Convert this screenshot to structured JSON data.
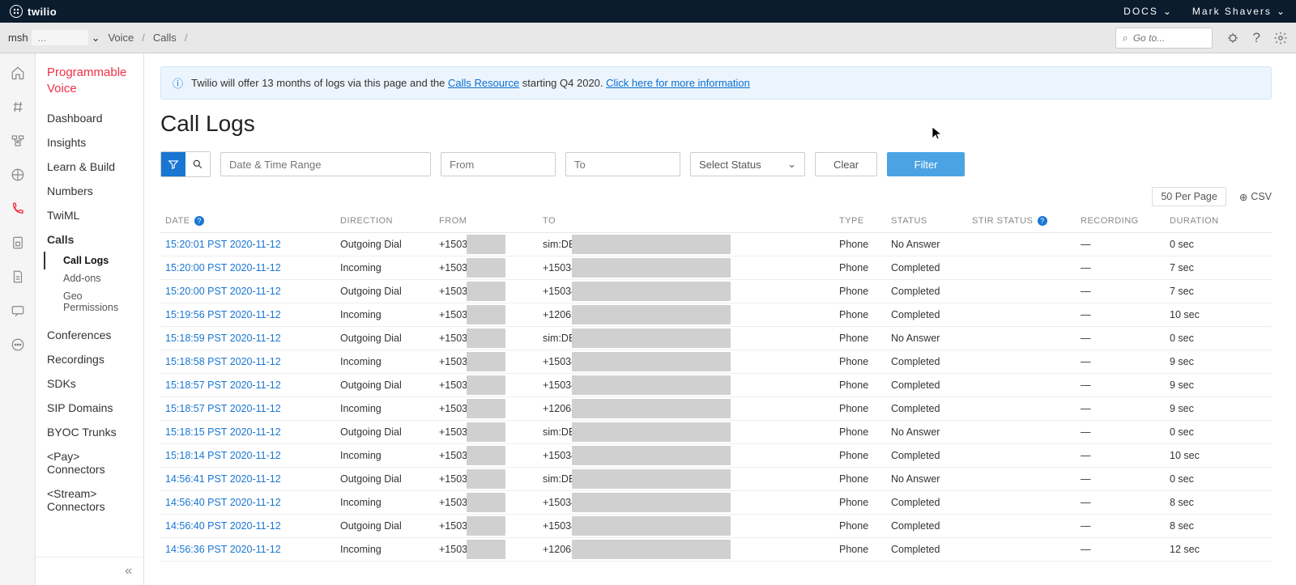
{
  "topbar": {
    "brand": "twilio",
    "docs": "DOCS",
    "user": "Mark Shavers"
  },
  "breadbar": {
    "account_prefix": "msh",
    "account_rest": "...",
    "crumb1": "Voice",
    "crumb2": "Calls",
    "search_placeholder": "Go to..."
  },
  "sidebar": {
    "title": "Programmable Voice",
    "items": [
      "Dashboard",
      "Insights",
      "Learn & Build",
      "Numbers",
      "TwiML",
      "Calls"
    ],
    "subs": [
      "Call Logs",
      "Add-ons",
      "Geo Permissions"
    ],
    "items2": [
      "Conferences",
      "Recordings",
      "SDKs",
      "SIP Domains",
      "BYOC Trunks",
      "<Pay> Connectors",
      "<Stream> Connectors"
    ]
  },
  "banner": {
    "text_a": "Twilio will offer 13 months of logs via this page and the ",
    "link1": "Calls Resource",
    "text_b": " starting Q4 2020. ",
    "link2": "Click here for more information"
  },
  "page": {
    "title": "Call Logs"
  },
  "filters": {
    "date_ph": "Date & Time Range",
    "from_ph": "From",
    "to_ph": "To",
    "status_ph": "Select Status",
    "clear": "Clear",
    "filter": "Filter",
    "per_page": "50 Per Page",
    "csv": "CSV"
  },
  "headers": {
    "date": "DATE",
    "direction": "DIRECTION",
    "from": "FROM",
    "to": "TO",
    "type": "TYPE",
    "status": "STATUS",
    "stir": "STIR STATUS",
    "recording": "RECORDING",
    "duration": "DURATION"
  },
  "rows": [
    {
      "date": "15:20:01 PST 2020-11-12",
      "dir": "Outgoing Dial",
      "from": "+1503",
      "to": "sim:DE",
      "type": "Phone",
      "status": "No Answer",
      "rec": "—",
      "dur": "0 sec"
    },
    {
      "date": "15:20:00 PST 2020-11-12",
      "dir": "Incoming",
      "from": "+1503",
      "to": "+15034",
      "type": "Phone",
      "status": "Completed",
      "rec": "—",
      "dur": "7 sec"
    },
    {
      "date": "15:20:00 PST 2020-11-12",
      "dir": "Outgoing Dial",
      "from": "+1503",
      "to": "+15034",
      "type": "Phone",
      "status": "Completed",
      "rec": "—",
      "dur": "7 sec"
    },
    {
      "date": "15:19:56 PST 2020-11-12",
      "dir": "Incoming",
      "from": "+1503",
      "to": "+12063",
      "type": "Phone",
      "status": "Completed",
      "rec": "—",
      "dur": "10 sec"
    },
    {
      "date": "15:18:59 PST 2020-11-12",
      "dir": "Outgoing Dial",
      "from": "+1503",
      "to": "sim:DE",
      "type": "Phone",
      "status": "No Answer",
      "rec": "—",
      "dur": "0 sec"
    },
    {
      "date": "15:18:58 PST 2020-11-12",
      "dir": "Incoming",
      "from": "+1503",
      "to": "+15034",
      "type": "Phone",
      "status": "Completed",
      "rec": "—",
      "dur": "9 sec"
    },
    {
      "date": "15:18:57 PST 2020-11-12",
      "dir": "Outgoing Dial",
      "from": "+1503",
      "to": "+15034",
      "type": "Phone",
      "status": "Completed",
      "rec": "—",
      "dur": "9 sec"
    },
    {
      "date": "15:18:57 PST 2020-11-12",
      "dir": "Incoming",
      "from": "+1503",
      "to": "+12063",
      "type": "Phone",
      "status": "Completed",
      "rec": "—",
      "dur": "9 sec"
    },
    {
      "date": "15:18:15 PST 2020-11-12",
      "dir": "Outgoing Dial",
      "from": "+1503",
      "to": "sim:DE",
      "type": "Phone",
      "status": "No Answer",
      "rec": "—",
      "dur": "0 sec"
    },
    {
      "date": "15:18:14 PST 2020-11-12",
      "dir": "Incoming",
      "from": "+1503",
      "to": "+15034",
      "type": "Phone",
      "status": "Completed",
      "rec": "—",
      "dur": "10 sec"
    },
    {
      "date": "14:56:41 PST 2020-11-12",
      "dir": "Outgoing Dial",
      "from": "+1503",
      "to": "sim:DE",
      "type": "Phone",
      "status": "No Answer",
      "rec": "—",
      "dur": "0 sec"
    },
    {
      "date": "14:56:40 PST 2020-11-12",
      "dir": "Incoming",
      "from": "+1503",
      "to": "+15034",
      "type": "Phone",
      "status": "Completed",
      "rec": "—",
      "dur": "8 sec"
    },
    {
      "date": "14:56:40 PST 2020-11-12",
      "dir": "Outgoing Dial",
      "from": "+1503",
      "to": "+15034",
      "type": "Phone",
      "status": "Completed",
      "rec": "—",
      "dur": "8 sec"
    },
    {
      "date": "14:56:36 PST 2020-11-12",
      "dir": "Incoming",
      "from": "+1503",
      "to": "+12063",
      "type": "Phone",
      "status": "Completed",
      "rec": "—",
      "dur": "12 sec"
    }
  ]
}
